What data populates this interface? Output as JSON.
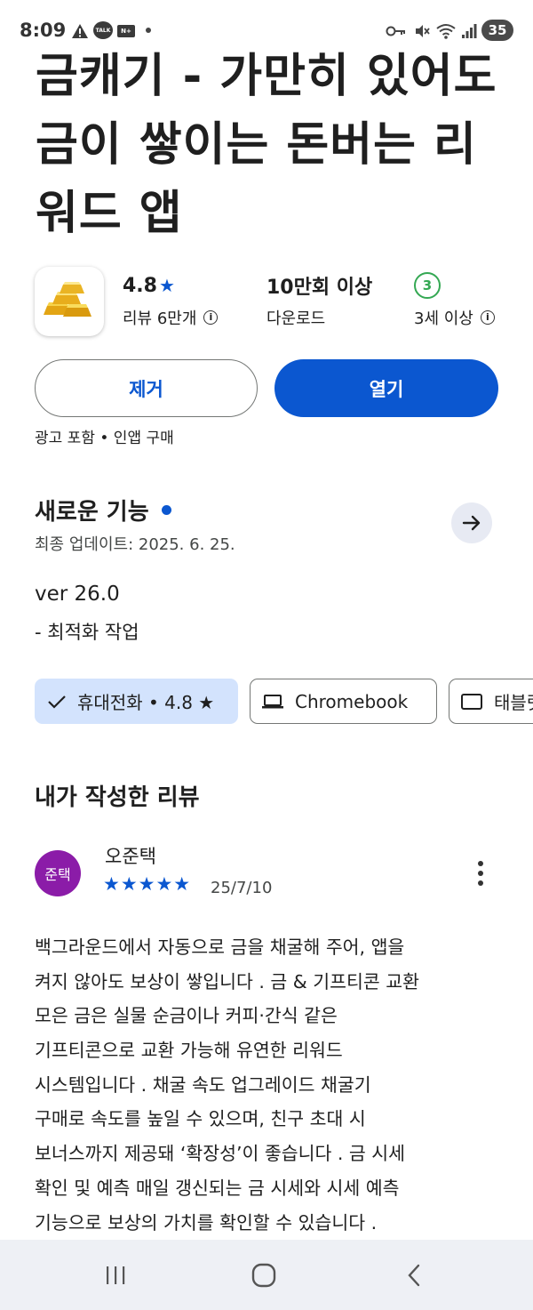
{
  "status_bar": {
    "time": "8:09",
    "talk_label": "TALK",
    "mail_label": "N+",
    "battery": "35"
  },
  "app": {
    "title": "금캐기 - 가만히 있어도 금이 쌓이는 돈버는 리워드 앱",
    "rating": "4.8",
    "reviews_label": "리뷰 6만개",
    "downloads": "10만회 이상",
    "downloads_label": "다운로드",
    "age_rating_badge": "3",
    "age_label": "3세 이상"
  },
  "actions": {
    "uninstall_label": "제거",
    "open_label": "열기",
    "ads_note": "광고 포함 • 인앱 구매"
  },
  "whats_new": {
    "title": "새로운 기능",
    "last_updated": "최종 업데이트: 2025. 6. 25.",
    "version": "ver 26.0",
    "note": "- 최적화 작업"
  },
  "device_chips": [
    {
      "label": "휴대전화 • 4.8 ★",
      "selected": true
    },
    {
      "label": "Chromebook",
      "selected": false
    },
    {
      "label": "태블릿",
      "selected": false
    }
  ],
  "my_review": {
    "heading": "내가 작성한 리뷰",
    "avatar_text": "준택",
    "avatar_color": "#8b1ca8",
    "reviewer": "오준택",
    "stars": "★★★★★",
    "date": "25/7/10",
    "body_lines": [
      "백그라운드에서 자동으로 금을 채굴해 주어, 앱을",
      "켜지 않아도 보상이 쌓입니다 . 금 & 기프티콘 교환",
      "모은 금은 실물 순금이나 커피·간식 같은",
      "기프티콘으로 교환 가능해 유연한 리워드",
      "시스템입니다 . 채굴 속도 업그레이드 채굴기",
      "구매로 속도를 높일 수 있으며, 친구 초대 시",
      "보너스까지 제공돼 ‘확장성’이 좋습니다 . 금 시세",
      "확인 및 예측 매일 갱신되는 금 시세와 시세 예측",
      "기능으로 보상의 가치를 확인할 수 있습니다 ."
    ]
  },
  "colors": {
    "accent": "#0b57d0",
    "chip_selected_bg": "#d3e3fd",
    "age_badge": "#34a853",
    "nav_bg": "#eef0f5"
  }
}
